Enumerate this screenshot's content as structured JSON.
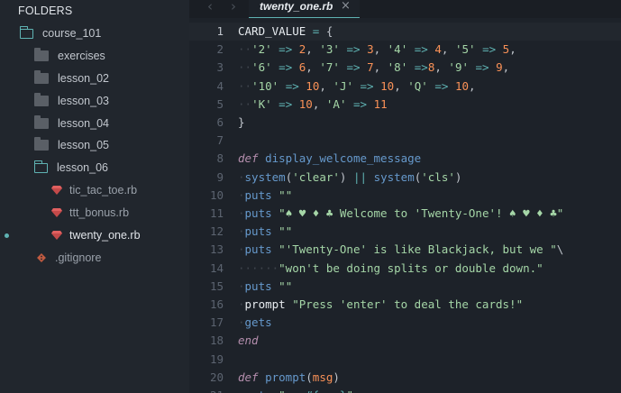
{
  "sidebar": {
    "header": "FOLDERS",
    "items": [
      {
        "label": "course_101",
        "type": "folder-open",
        "depth": 0
      },
      {
        "label": "exercises",
        "type": "folder",
        "depth": 1
      },
      {
        "label": "lesson_02",
        "type": "folder",
        "depth": 1
      },
      {
        "label": "lesson_03",
        "type": "folder",
        "depth": 1
      },
      {
        "label": "lesson_04",
        "type": "folder",
        "depth": 1
      },
      {
        "label": "lesson_05",
        "type": "folder",
        "depth": 1
      },
      {
        "label": "lesson_06",
        "type": "folder-open",
        "depth": 1
      },
      {
        "label": "tic_tac_toe.rb",
        "type": "ruby-file",
        "depth": 2
      },
      {
        "label": "ttt_bonus.rb",
        "type": "ruby-file",
        "depth": 2
      },
      {
        "label": "twenty_one.rb",
        "type": "ruby-file",
        "depth": 2,
        "active": true
      },
      {
        "label": ".gitignore",
        "type": "git-file",
        "depth": 1
      }
    ]
  },
  "tabbar": {
    "back_arrow": "‹",
    "forward_arrow": "›",
    "active_tab": "twenty_one.rb",
    "close_glyph": "×"
  },
  "editor": {
    "line_numbers": [
      "1",
      "2",
      "3",
      "4",
      "5",
      "6",
      "7",
      "8",
      "9",
      "10",
      "11",
      "12",
      "13",
      "14",
      "15",
      "16",
      "17",
      "18",
      "19",
      "20",
      "21"
    ],
    "current_line": 1,
    "lines": [
      [
        [
          "const",
          "CARD_VALUE"
        ],
        [
          "ws",
          " "
        ],
        [
          "op",
          "="
        ],
        [
          "ws",
          " "
        ],
        [
          "punct",
          "{"
        ]
      ],
      [
        [
          "ws",
          "··"
        ],
        [
          "str",
          "'2'"
        ],
        [
          "ws",
          " "
        ],
        [
          "op",
          "=>"
        ],
        [
          "ws",
          " "
        ],
        [
          "num",
          "2"
        ],
        [
          "punct",
          ", "
        ],
        [
          "str",
          "'3'"
        ],
        [
          "ws",
          " "
        ],
        [
          "op",
          "=>"
        ],
        [
          "ws",
          " "
        ],
        [
          "num",
          "3"
        ],
        [
          "punct",
          ", "
        ],
        [
          "str",
          "'4'"
        ],
        [
          "ws",
          " "
        ],
        [
          "op",
          "=>"
        ],
        [
          "ws",
          " "
        ],
        [
          "num",
          "4"
        ],
        [
          "punct",
          ", "
        ],
        [
          "str",
          "'5'"
        ],
        [
          "ws",
          " "
        ],
        [
          "op",
          "=>"
        ],
        [
          "ws",
          " "
        ],
        [
          "num",
          "5"
        ],
        [
          "punct",
          ","
        ]
      ],
      [
        [
          "ws",
          "··"
        ],
        [
          "str",
          "'6'"
        ],
        [
          "ws",
          " "
        ],
        [
          "op",
          "=>"
        ],
        [
          "ws",
          " "
        ],
        [
          "num",
          "6"
        ],
        [
          "punct",
          ", "
        ],
        [
          "str",
          "'7'"
        ],
        [
          "ws",
          " "
        ],
        [
          "op",
          "=>"
        ],
        [
          "ws",
          " "
        ],
        [
          "num",
          "7"
        ],
        [
          "punct",
          ", "
        ],
        [
          "str",
          "'8'"
        ],
        [
          "ws",
          " "
        ],
        [
          "op",
          "=>"
        ],
        [
          "num",
          "8"
        ],
        [
          "punct",
          ", "
        ],
        [
          "str",
          "'9'"
        ],
        [
          "ws",
          " "
        ],
        [
          "op",
          "=>"
        ],
        [
          "ws",
          " "
        ],
        [
          "num",
          "9"
        ],
        [
          "punct",
          ","
        ]
      ],
      [
        [
          "ws",
          "··"
        ],
        [
          "str",
          "'10'"
        ],
        [
          "ws",
          " "
        ],
        [
          "op",
          "=>"
        ],
        [
          "ws",
          " "
        ],
        [
          "num",
          "10"
        ],
        [
          "punct",
          ", "
        ],
        [
          "str",
          "'J'"
        ],
        [
          "ws",
          " "
        ],
        [
          "op",
          "=>"
        ],
        [
          "ws",
          " "
        ],
        [
          "num",
          "10"
        ],
        [
          "punct",
          ", "
        ],
        [
          "str",
          "'Q'"
        ],
        [
          "ws",
          " "
        ],
        [
          "op",
          "=>"
        ],
        [
          "ws",
          " "
        ],
        [
          "num",
          "10"
        ],
        [
          "punct",
          ","
        ]
      ],
      [
        [
          "ws",
          "··"
        ],
        [
          "str",
          "'K'"
        ],
        [
          "ws",
          " "
        ],
        [
          "op",
          "=>"
        ],
        [
          "ws",
          " "
        ],
        [
          "num",
          "10"
        ],
        [
          "punct",
          ", "
        ],
        [
          "str",
          "'A'"
        ],
        [
          "ws",
          " "
        ],
        [
          "op",
          "=>"
        ],
        [
          "ws",
          " "
        ],
        [
          "num",
          "11"
        ]
      ],
      [
        [
          "punct",
          "}"
        ]
      ],
      [],
      [
        [
          "kw",
          "def"
        ],
        [
          "ws",
          " "
        ],
        [
          "fn",
          "display_welcome_message"
        ]
      ],
      [
        [
          "ws",
          "·"
        ],
        [
          "meth",
          "system"
        ],
        [
          "punct",
          "("
        ],
        [
          "str",
          "'clear'"
        ],
        [
          "punct",
          ")"
        ],
        [
          "ws",
          " "
        ],
        [
          "op",
          "||"
        ],
        [
          "ws",
          " "
        ],
        [
          "meth",
          "system"
        ],
        [
          "punct",
          "("
        ],
        [
          "str",
          "'cls'"
        ],
        [
          "punct",
          ")"
        ]
      ],
      [
        [
          "ws",
          "·"
        ],
        [
          "meth",
          "puts"
        ],
        [
          "ws",
          " "
        ],
        [
          "str",
          "\"\""
        ]
      ],
      [
        [
          "ws",
          "·"
        ],
        [
          "meth",
          "puts"
        ],
        [
          "ws",
          " "
        ],
        [
          "str",
          "\"♠ ♥ ♦ ♣ Welcome to 'Twenty-One'! ♠ ♥ ♦ ♣\""
        ]
      ],
      [
        [
          "ws",
          "·"
        ],
        [
          "meth",
          "puts"
        ],
        [
          "ws",
          " "
        ],
        [
          "str",
          "\"\""
        ]
      ],
      [
        [
          "ws",
          "·"
        ],
        [
          "meth",
          "puts"
        ],
        [
          "ws",
          " "
        ],
        [
          "str",
          "\"'Twenty-One' is like Blackjack, but we \""
        ],
        [
          "punct",
          "\\"
        ]
      ],
      [
        [
          "ws",
          "······"
        ],
        [
          "str",
          "\"won't be doing splits or double down.\""
        ]
      ],
      [
        [
          "ws",
          "·"
        ],
        [
          "meth",
          "puts"
        ],
        [
          "ws",
          " "
        ],
        [
          "str",
          "\"\""
        ]
      ],
      [
        [
          "ws",
          "·"
        ],
        [
          "ident",
          "prompt"
        ],
        [
          "ws",
          " "
        ],
        [
          "str",
          "\"Press 'enter' to deal the cards!\""
        ]
      ],
      [
        [
          "ws",
          "·"
        ],
        [
          "meth",
          "gets"
        ]
      ],
      [
        [
          "kw",
          "end"
        ]
      ],
      [],
      [
        [
          "kw",
          "def"
        ],
        [
          "ws",
          " "
        ],
        [
          "fn",
          "prompt"
        ],
        [
          "punct",
          "("
        ],
        [
          "param",
          "msg"
        ],
        [
          "punct",
          ")"
        ]
      ],
      [
        [
          "ws",
          "·"
        ],
        [
          "meth",
          "puts"
        ],
        [
          "ws",
          " "
        ],
        [
          "str",
          "\"=> "
        ],
        [
          "interp",
          "#{msg}"
        ],
        [
          "str",
          "\""
        ]
      ]
    ]
  }
}
